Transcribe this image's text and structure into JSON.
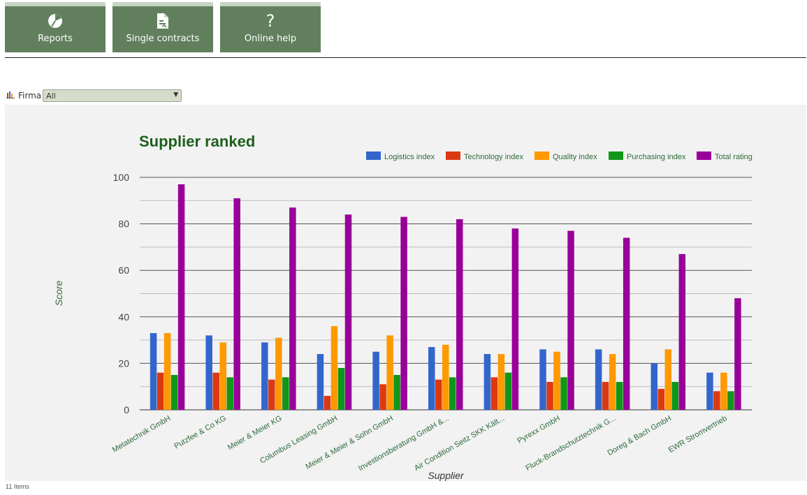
{
  "nav": {
    "tiles": [
      {
        "label": "Reports",
        "icon": "pie-chart-icon"
      },
      {
        "label": "Single contracts",
        "icon": "contract-document-icon"
      },
      {
        "label": "Online help",
        "icon": "question-mark-icon"
      }
    ]
  },
  "filter": {
    "label": "Firma",
    "icon": "bar-chart-icon",
    "selected": "All"
  },
  "footer": {
    "items_count": "11 Items"
  },
  "colors": {
    "tile_bg": "#617f5d",
    "title": "#1e5f1e",
    "axis_label": "#2d6a3a"
  },
  "chart_data": {
    "type": "bar",
    "title": "Supplier ranked",
    "xlabel": "Supplier",
    "ylabel": "Score",
    "ylim": [
      0,
      100
    ],
    "yticks": [
      0,
      20,
      40,
      60,
      80,
      100
    ],
    "grid": true,
    "legend_position": "top-right",
    "categories": [
      "Metatechnik GmbH",
      "Putzfee & Co KG",
      "Meier & Meier KG",
      "Columbus Leasing GmbH",
      "Meier & Meier & Sohn GmbH",
      "Investionsberatung GmbH &...",
      "Air Condition Seitz SKK Kält...",
      "Pyrexx GmbH",
      "Fluck-Brandschutztechnik G...",
      "Doreg & Bach GmbH",
      "EWR Stromvertrieb"
    ],
    "series": [
      {
        "name": "Logistics index",
        "color": "#3366cc",
        "values": [
          33,
          32,
          29,
          24,
          25,
          27,
          24,
          26,
          26,
          20,
          16
        ]
      },
      {
        "name": "Technology index",
        "color": "#dc3912",
        "values": [
          16,
          16,
          13,
          6,
          11,
          13,
          14,
          12,
          12,
          9,
          8
        ]
      },
      {
        "name": "Quality index",
        "color": "#ff9900",
        "values": [
          33,
          29,
          31,
          36,
          32,
          28,
          24,
          25,
          24,
          26,
          16
        ]
      },
      {
        "name": "Purchasing index",
        "color": "#109618",
        "values": [
          15,
          14,
          14,
          18,
          15,
          14,
          16,
          14,
          12,
          12,
          8
        ]
      },
      {
        "name": "Total rating",
        "color": "#990099",
        "values": [
          97,
          91,
          87,
          84,
          83,
          82,
          78,
          77,
          74,
          67,
          48
        ]
      }
    ]
  }
}
